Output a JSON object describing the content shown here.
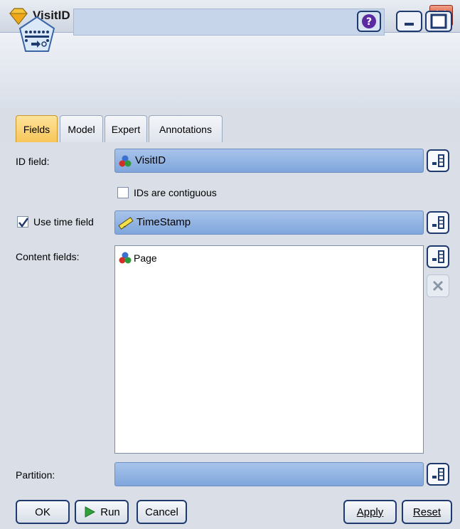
{
  "window": {
    "title": "VisitID",
    "close_icon": "close-icon",
    "title_icon": "yellow-diamond-icon",
    "accent_close": "#d9452a"
  },
  "header": {
    "node_icon": "sequence-node-icon",
    "name_value": "",
    "help_icon": "help-icon",
    "minimize_icon": "minimize-icon",
    "maximize_icon": "maximize-icon"
  },
  "tabs": [
    {
      "label": "Fields",
      "active": true
    },
    {
      "label": "Model",
      "active": false
    },
    {
      "label": "Expert",
      "active": false
    },
    {
      "label": "Annotations",
      "active": false
    }
  ],
  "fields": {
    "id_field_label": "ID field:",
    "id_field_value": "VisitID",
    "ids_contiguous_label": "IDs are contiguous",
    "ids_contiguous_checked": false,
    "use_time_label": "Use time field",
    "use_time_checked": true,
    "time_field_value": "TimeStamp",
    "content_fields_label": "Content fields:",
    "content_fields": [
      "Page"
    ],
    "partition_label": "Partition:",
    "partition_value": ""
  },
  "buttons": {
    "ok": "OK",
    "run": "Run",
    "cancel": "Cancel",
    "apply": "Apply",
    "reset": "Reset"
  }
}
